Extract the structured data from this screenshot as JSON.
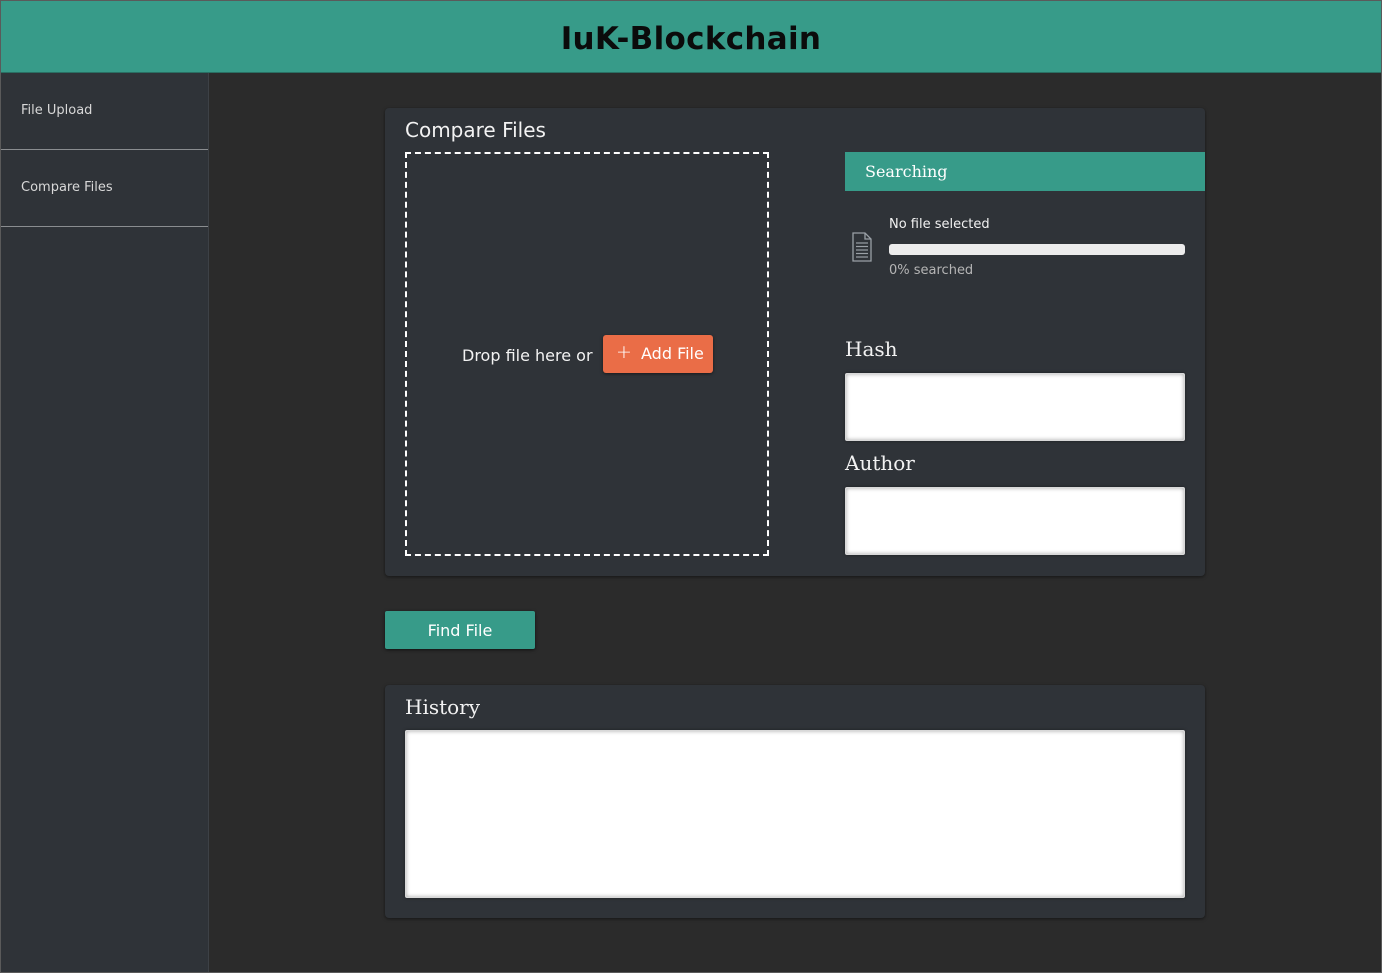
{
  "app": {
    "title": "IuK-Blockchain"
  },
  "sidebar": {
    "items": [
      {
        "label": "File Upload"
      },
      {
        "label": "Compare Files"
      }
    ]
  },
  "compare": {
    "title": "Compare Files",
    "dropzone": {
      "text": "Drop file here or",
      "add_button_label": "Add File",
      "add_icon": "plus-icon"
    },
    "status": {
      "header": "Searching",
      "file_name": "No file selected",
      "progress_fraction": 0,
      "progress_text": "0% searched",
      "file_icon": "file-icon"
    },
    "hash": {
      "label": "Hash",
      "value": ""
    },
    "author": {
      "label": "Author",
      "value": ""
    }
  },
  "actions": {
    "find_label": "Find File"
  },
  "history": {
    "title": "History",
    "value": ""
  },
  "colors": {
    "accent": "#379b89",
    "add_button": "#ea6d47",
    "background": "#2b2b2b",
    "panel": "#2f3338"
  }
}
